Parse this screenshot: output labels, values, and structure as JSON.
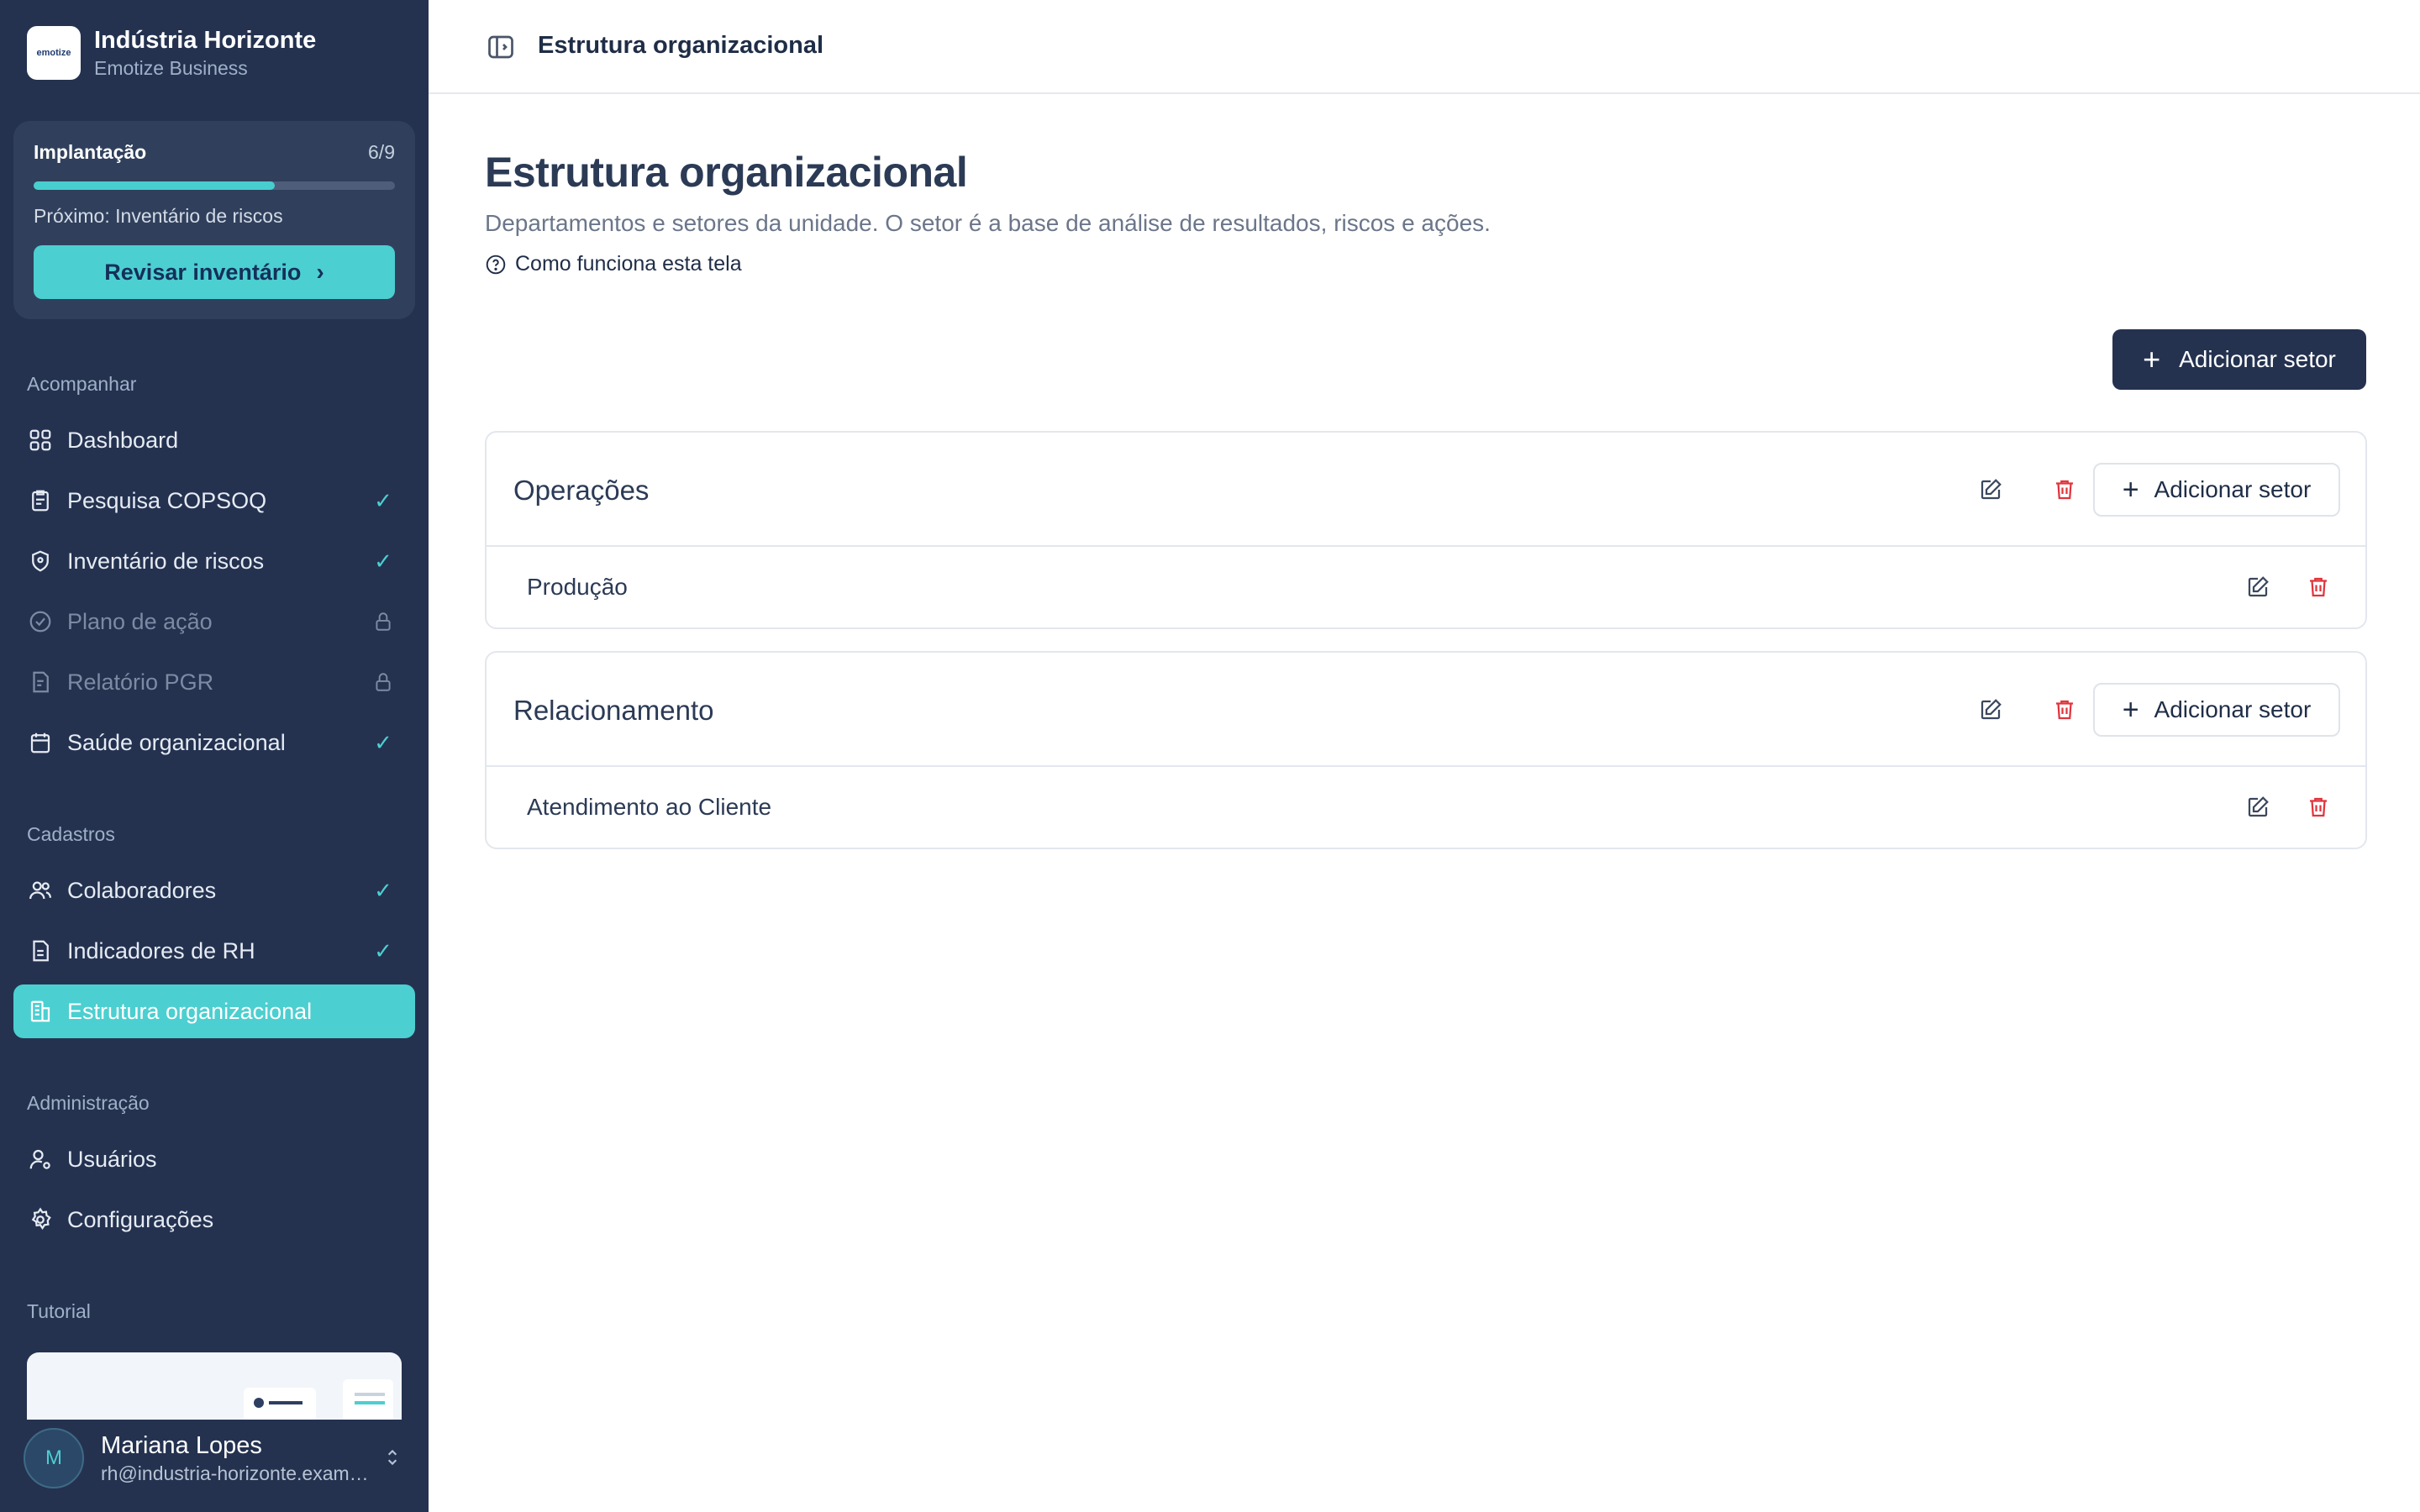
{
  "brand": {
    "name": "Indústria Horizonte",
    "subtitle": "Emotize Business",
    "logo_text": "emotize"
  },
  "implantacao": {
    "title": "Implantação",
    "count": "6/9",
    "progress": 0.667,
    "next": "Próximo: Inventário de riscos",
    "button": "Revisar inventário"
  },
  "sections": {
    "acompanhar": "Acompanhar",
    "cadastros": "Cadastros",
    "administracao": "Administração",
    "tutorial": "Tutorial"
  },
  "nav": {
    "dashboard": "Dashboard",
    "pesquisa": "Pesquisa COPSOQ",
    "inventario": "Inventário de riscos",
    "plano": "Plano de ação",
    "relatorio": "Relatório PGR",
    "saude": "Saúde organizacional",
    "colaboradores": "Colaboradores",
    "indicadores": "Indicadores de RH",
    "estrutura": "Estrutura organizacional",
    "usuarios": "Usuários",
    "configuracoes": "Configurações"
  },
  "user": {
    "initial": "M",
    "name": "Mariana Lopes",
    "email": "rh@industria-horizonte.example.com"
  },
  "topbar": {
    "title": "Estrutura organizacional"
  },
  "page": {
    "title": "Estrutura organizacional",
    "description": "Departamentos e setores da unidade. O setor é a base de análise de resultados, riscos e ações.",
    "help": "Como funciona esta tela",
    "add_button": "Adicionar setor"
  },
  "departments": [
    {
      "name": "Operações",
      "add_label": "Adicionar setor",
      "sectors": [
        "Produção"
      ]
    },
    {
      "name": "Relacionamento",
      "add_label": "Adicionar setor",
      "sectors": [
        "Atendimento ao Cliente"
      ]
    }
  ],
  "colors": {
    "sidebar": "#243250",
    "accent": "#4ccfd0",
    "danger": "#e0343c"
  }
}
